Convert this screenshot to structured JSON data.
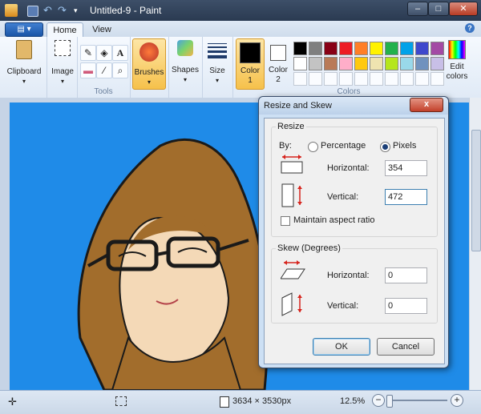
{
  "titlebar": {
    "title": "Untitled-9 - Paint",
    "minimize": "–",
    "maximize": "□",
    "close": "✕"
  },
  "tabs": {
    "menu": "▤ ▾",
    "home": "Home",
    "view": "View",
    "help": "?"
  },
  "ribbon": {
    "clipboard": "Clipboard",
    "image": "Image",
    "tools_group": "Tools",
    "brushes": "Brushes",
    "shapes": "Shapes",
    "size": "Size",
    "color1_a": "Color",
    "color1_b": "1",
    "color2_a": "Color",
    "color2_b": "2",
    "colors_group": "Colors",
    "edit_colors_a": "Edit",
    "edit_colors_b": "colors",
    "palette": [
      "#000000",
      "#7f7f7f",
      "#880015",
      "#ed1c24",
      "#ff7f27",
      "#fff200",
      "#22b14c",
      "#00a2e8",
      "#3f48cc",
      "#a349a4",
      "#ffffff",
      "#c3c3c3",
      "#b97a57",
      "#ffaec9",
      "#ffc90e",
      "#efe4b0",
      "#b5e61d",
      "#99d9ea",
      "#7092be",
      "#c8bfe7"
    ]
  },
  "dialog": {
    "title": "Resize and Skew",
    "close": "x",
    "resize_legend": "Resize",
    "by_label": "By:",
    "percentage": "Percentage",
    "pixels": "Pixels",
    "resize_horizontal_label": "Horizontal:",
    "resize_horizontal_value": "354",
    "resize_vertical_label": "Vertical:",
    "resize_vertical_value": "472",
    "maintain_aspect": "Maintain aspect ratio",
    "skew_legend": "Skew (Degrees)",
    "skew_horizontal_label": "Horizontal:",
    "skew_horizontal_value": "0",
    "skew_vertical_label": "Vertical:",
    "skew_vertical_value": "0",
    "ok": "OK",
    "cancel": "Cancel"
  },
  "status": {
    "dimensions": "3634 × 3530px",
    "zoom": "12.5%",
    "zoom_minus": "−",
    "zoom_plus": "+"
  }
}
